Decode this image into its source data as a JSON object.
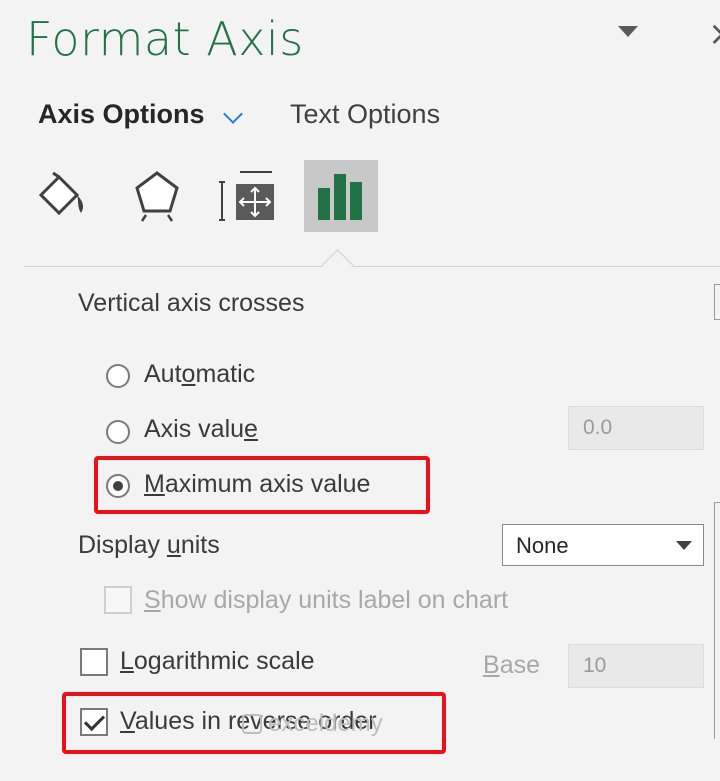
{
  "panel": {
    "title": "Format Axis"
  },
  "tabs": [
    {
      "label": "Axis Options",
      "active": true
    },
    {
      "label": "Text Options",
      "active": false
    }
  ],
  "icon_tabs": [
    "fill-line-icon",
    "effects-pentagon-icon",
    "size-properties-icon",
    "axis-options-bar-chart-icon"
  ],
  "vertical_axis_crosses": {
    "label": "Vertical axis crosses",
    "options": [
      {
        "pre": "Aut",
        "mnemonic": "o",
        "post": "matic",
        "selected": false
      },
      {
        "pre": "Axis valu",
        "mnemonic": "e",
        "post": "",
        "selected": false
      },
      {
        "pre": "",
        "mnemonic": "M",
        "post": "aximum axis value",
        "selected": true
      }
    ],
    "axis_value_input": "0.0"
  },
  "display_units": {
    "pre": "Display ",
    "mnemonic": "u",
    "post": "nits",
    "selected": "None",
    "show_label": {
      "pre": "",
      "mnemonic": "S",
      "post": "how display units label on chart",
      "checked": false,
      "disabled": true
    }
  },
  "logarithmic_scale": {
    "pre": "",
    "mnemonic": "L",
    "post": "ogarithmic scale",
    "checked": false,
    "base_label": {
      "pre": "",
      "mnemonic": "B",
      "post": "ase"
    },
    "base_value": "10"
  },
  "reverse_order": {
    "pre": "",
    "mnemonic": "V",
    "post": "alues in reverse order",
    "checked": true
  },
  "watermark": {
    "text": "exceldemy"
  },
  "colors": {
    "brand_green": "#217346",
    "highlight_red": "#e8121c",
    "accent_blue": "#2b7cd3"
  }
}
